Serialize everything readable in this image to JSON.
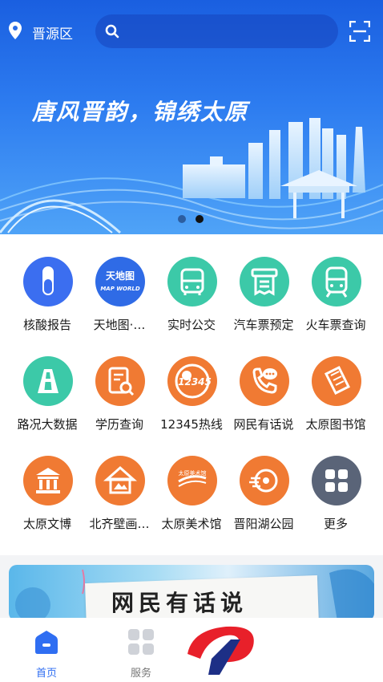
{
  "location": {
    "district": "晋源区"
  },
  "search": {
    "placeholder": ""
  },
  "banner": {
    "slogan": "唐风晋韵，锦绣太原",
    "pages": 2,
    "active_page": 2
  },
  "services": [
    {
      "label": "核酸报告",
      "icon": "test-tube-icon",
      "color": "#3b6ef0"
    },
    {
      "label": "天地图·…",
      "icon": "map-world-icon",
      "color": "#2f6be6"
    },
    {
      "label": "实时公交",
      "icon": "bus-icon",
      "color": "#3cc9a8"
    },
    {
      "label": "汽车票预定",
      "icon": "ticket-icon",
      "color": "#3cc9a8"
    },
    {
      "label": "火车票查询",
      "icon": "train-icon",
      "color": "#3cc9a8"
    },
    {
      "label": "路况大数据",
      "icon": "road-icon",
      "color": "#3cc9a8"
    },
    {
      "label": "学历查询",
      "icon": "document-search-icon",
      "color": "#f07a33"
    },
    {
      "label": "12345热线",
      "icon": "hotline-12345-icon",
      "color": "#f07a33"
    },
    {
      "label": "网民有话说",
      "icon": "phone-chat-icon",
      "color": "#f07a33"
    },
    {
      "label": "太原图书馆",
      "icon": "library-book-icon",
      "color": "#f07a33"
    },
    {
      "label": "太原文博",
      "icon": "museum-icon",
      "color": "#f07a33"
    },
    {
      "label": "北齐壁画…",
      "icon": "house-picture-icon",
      "color": "#f07a33"
    },
    {
      "label": "太原美术馆",
      "icon": "art-gallery-icon",
      "color": "#f07a33"
    },
    {
      "label": "晋阳湖公园",
      "icon": "park-icon",
      "color": "#f07a33"
    },
    {
      "label": "更多",
      "icon": "more-grid-icon",
      "color": "#5a6478"
    }
  ],
  "promo": {
    "title": "网民有话说"
  },
  "tabs": [
    {
      "label": "首页",
      "icon": "home-icon",
      "active": true
    },
    {
      "label": "服务",
      "icon": "apps-grid-icon",
      "active": false
    }
  ],
  "colors": {
    "accent": "#2f6ef2",
    "teal": "#3cc9a8",
    "orange": "#f07a33"
  }
}
